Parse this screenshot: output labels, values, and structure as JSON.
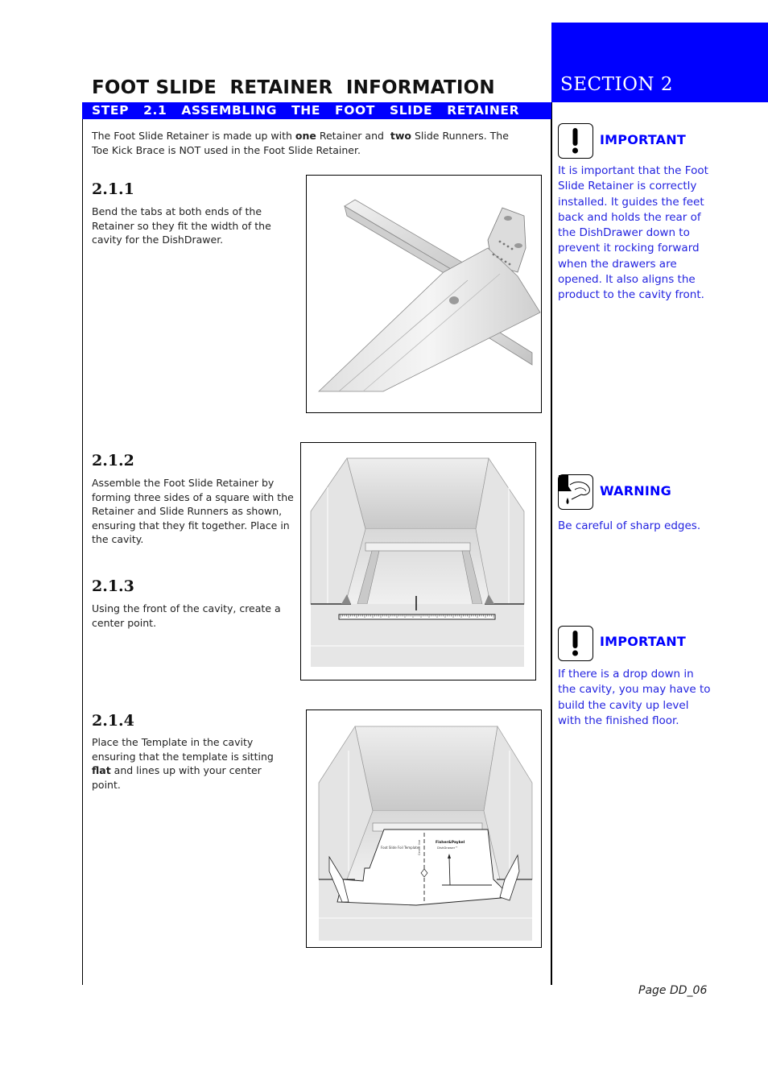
{
  "header": {
    "page_title": "FOOT SLIDE  RETAINER  INFORMATION",
    "section_title": "SECTION  2",
    "step_title": "STEP  2.1  ASSEMBLING  THE  FOOT  SLIDE  RETAINER"
  },
  "intro": {
    "parts": [
      "The Foot Slide Retainer is made up with ",
      "one",
      " Retainer and  ",
      "two",
      " Slide Runners. The Toe Kick Brace is NOT used in the Foot Slide Retainer."
    ]
  },
  "steps": [
    {
      "number": "2.1.1",
      "text": "Bend the tabs at both ends of the Retainer so they fit the width of the cavity for the DishDrawer."
    },
    {
      "number": "2.1.2",
      "text": "Assemble the Foot Slide Retainer by forming three sides of a square with the Retainer and Slide Runners as shown, ensuring that they fit together.  Place in the cavity."
    },
    {
      "number": "2.1.3",
      "text": "Using the front of the cavity, create a center point."
    },
    {
      "number": "2.1.4",
      "text_parts": [
        "Place the Template in the cavity ensuring that the template is sitting ",
        "flat",
        " and lines up with your center point."
      ]
    }
  ],
  "figures": {
    "fig_211": {
      "alt": "Retainer and slide runner bracket"
    },
    "fig_212_213": {
      "alt": "Assembled retainer in cavity with ruler at front"
    },
    "fig_214": {
      "alt": "Template placed in cavity",
      "template_label": "Foot Slide Foil Template",
      "center_line_label": "Center line",
      "brand": "Fisher&Paykel",
      "product": "DishDrawer™"
    }
  },
  "notices": [
    {
      "type": "important",
      "icon": "exclamation-icon",
      "label": "IMPORTANT",
      "text": "It is important that the Foot Slide Retainer is correctly installed.  It  guides the feet back and holds the rear of the DishDrawer down to prevent it rocking forward when the drawers are opened. It also aligns the product to the cavity front."
    },
    {
      "type": "warning",
      "icon": "sharp-edge-finger-icon",
      "label": "WARNING",
      "text": "Be careful of sharp edges."
    },
    {
      "type": "important",
      "icon": "exclamation-icon",
      "label": "IMPORTANT",
      "text": "If there is a drop down in the cavity, you may have to build the cavity up level with the finished floor."
    }
  ],
  "footer": {
    "page_number": "Page DD_06"
  },
  "colors": {
    "accent": "#0000ff",
    "notice_text": "#2323e0"
  }
}
